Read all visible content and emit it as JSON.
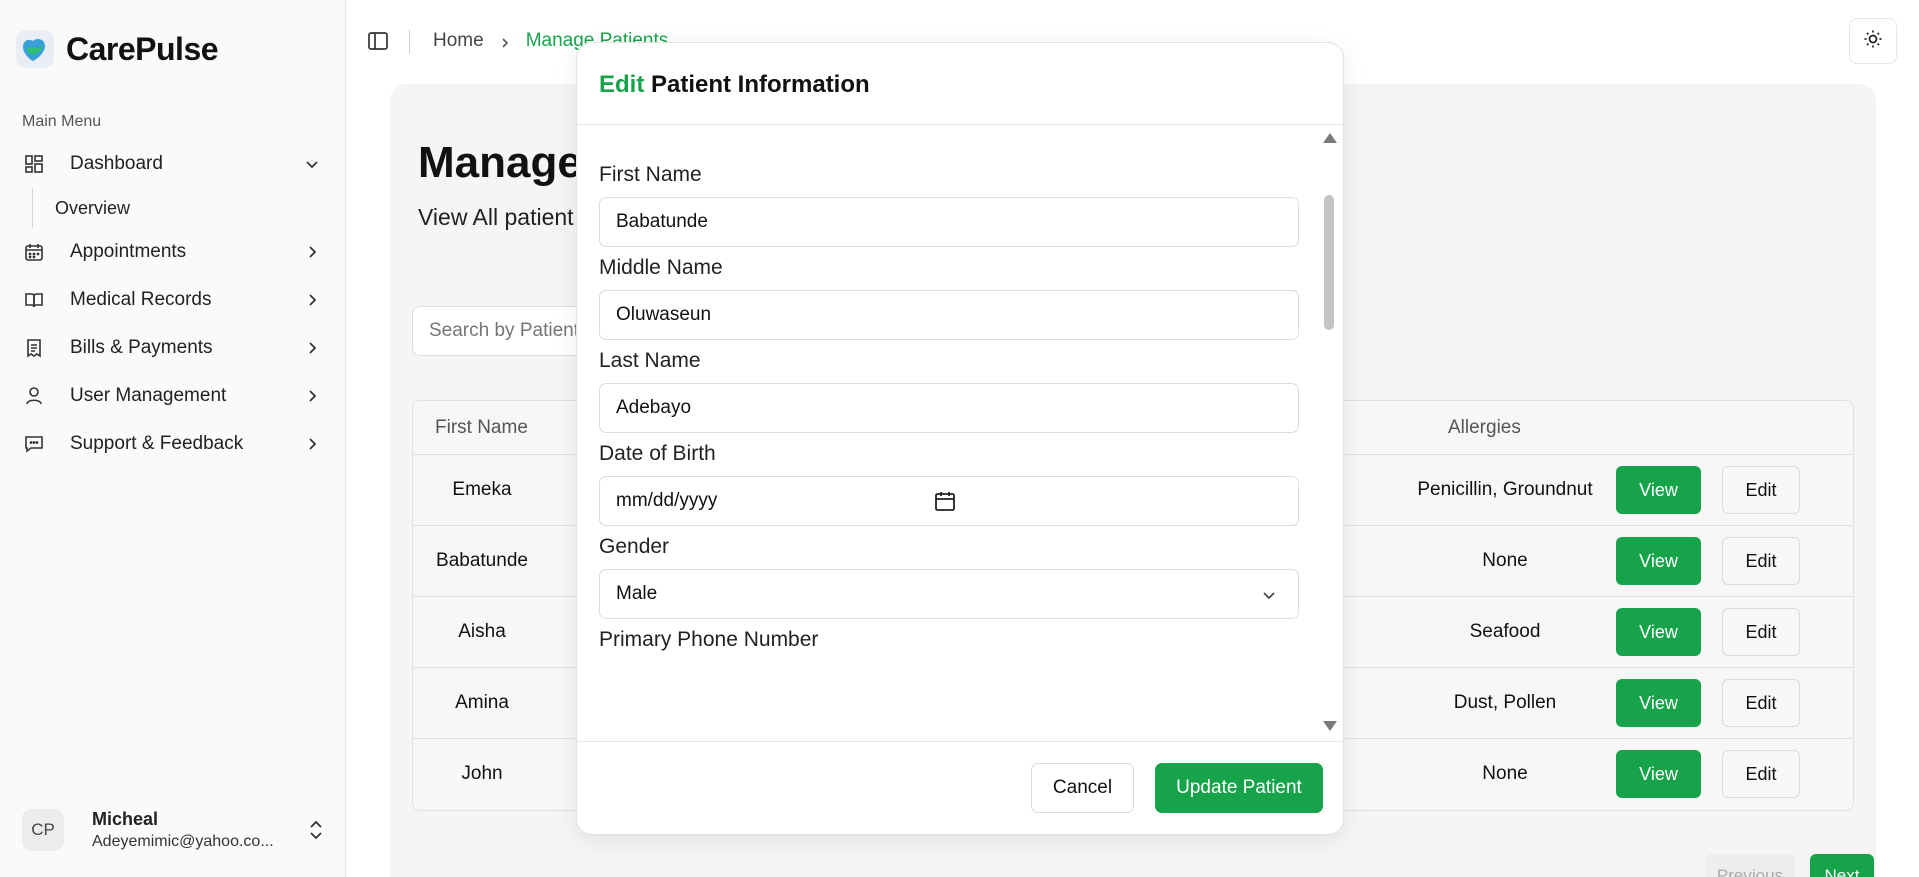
{
  "brand": {
    "name": "CarePulse"
  },
  "sidebar": {
    "menu_label": "Main Menu",
    "items": [
      {
        "label": "Dashboard",
        "icon": "dashboard-icon",
        "expanded": true
      },
      {
        "label": "Appointments",
        "icon": "calendar-icon"
      },
      {
        "label": "Medical Records",
        "icon": "book-icon"
      },
      {
        "label": "Bills & Payments",
        "icon": "receipt-icon"
      },
      {
        "label": "User Management",
        "icon": "user-icon"
      },
      {
        "label": "Support & Feedback",
        "icon": "message-icon"
      }
    ],
    "subitem": "Overview",
    "user": {
      "initials": "CP",
      "name": "Micheal",
      "email": "Adeyemimic@yahoo.co..."
    }
  },
  "breadcrumb": {
    "home": "Home",
    "current": "Manage Patients"
  },
  "page": {
    "title": "Manage",
    "subtitle": "View All patient",
    "search_placeholder": "Search by Patient"
  },
  "table": {
    "columns": {
      "first_name": "First Name",
      "allergies": "Allergies"
    },
    "rows": [
      {
        "first_name": "Emeka",
        "allergies": "Penicillin, Groundnut"
      },
      {
        "first_name": "Babatunde",
        "allergies": "None"
      },
      {
        "first_name": "Aisha",
        "allergies": "Seafood"
      },
      {
        "first_name": "Amina",
        "allergies": "Dust, Pollen"
      },
      {
        "first_name": "John",
        "allergies": "None"
      }
    ],
    "view_label": "View",
    "edit_label": "Edit"
  },
  "pagination": {
    "prev": "Previous",
    "next": "Next"
  },
  "modal": {
    "title_accent": "Edit",
    "title_rest": "Patient Information",
    "fields": {
      "first_name": {
        "label": "First Name",
        "value": "Babatunde"
      },
      "middle_name": {
        "label": "Middle Name",
        "value": "Oluwaseun"
      },
      "last_name": {
        "label": "Last Name",
        "value": "Adebayo"
      },
      "dob": {
        "label": "Date of Birth",
        "placeholder": "mm/dd/yyyy"
      },
      "gender": {
        "label": "Gender",
        "value": "Male"
      },
      "phone": {
        "label": "Primary Phone Number"
      }
    },
    "cancel_label": "Cancel",
    "update_label": "Update Patient"
  },
  "colors": {
    "accent": "#16a34a",
    "sidebar_bg": "#fafafa",
    "main_bg": "#f5f5f5"
  }
}
